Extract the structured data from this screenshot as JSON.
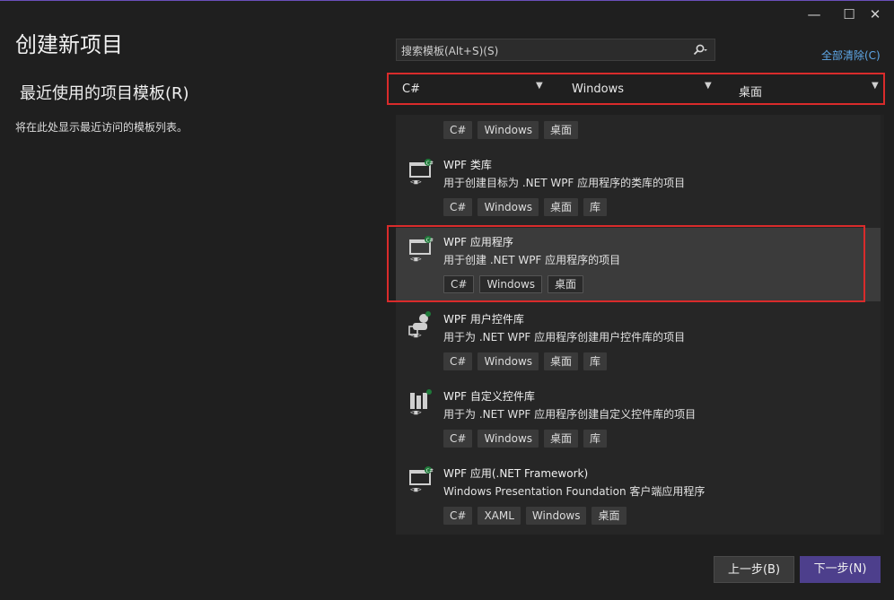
{
  "window": {
    "minimize_glyph": "—",
    "maximize_glyph": "☐",
    "close_glyph": "✕"
  },
  "page": {
    "title": "创建新项目",
    "recent_title": "最近使用的项目模板(R)",
    "recent_desc": "将在此处显示最近访问的模板列表。"
  },
  "search": {
    "placeholder": "搜索模板(Alt+S)(S)",
    "icon": "search-icon"
  },
  "clear_all": "全部清除(C)",
  "filters": {
    "language": "C#",
    "platform": "Windows",
    "project_type": "桌面"
  },
  "templates": [
    {
      "name": "",
      "desc": "",
      "tags": [
        "C#",
        "Windows",
        "桌面"
      ],
      "icon": "partial-item"
    },
    {
      "name": "WPF 类库",
      "desc": "用于创建目标为 .NET WPF 应用程序的类库的项目",
      "tags": [
        "C#",
        "Windows",
        "桌面",
        "库"
      ],
      "icon": "wpf-window-icon"
    },
    {
      "name": "WPF 应用程序",
      "desc": "用于创建 .NET WPF 应用程序的项目",
      "tags": [
        "C#",
        "Windows",
        "桌面"
      ],
      "icon": "wpf-window-icon",
      "selected": true
    },
    {
      "name": "WPF 用户控件库",
      "desc": "用于为 .NET WPF 应用程序创建用户控件库的项目",
      "tags": [
        "C#",
        "Windows",
        "桌面",
        "库"
      ],
      "icon": "wpf-user-control-icon"
    },
    {
      "name": "WPF 自定义控件库",
      "desc": "用于为 .NET WPF 应用程序创建自定义控件库的项目",
      "tags": [
        "C#",
        "Windows",
        "桌面",
        "库"
      ],
      "icon": "wpf-custom-control-icon"
    },
    {
      "name": "WPF 应用(.NET Framework)",
      "desc": "Windows Presentation Foundation 客户端应用程序",
      "tags": [
        "C#",
        "XAML",
        "Windows",
        "桌面"
      ],
      "icon": "wpf-window-icon"
    }
  ],
  "buttons": {
    "back": "上一步(B)",
    "next": "下一步(N)"
  },
  "colors": {
    "accent": "#4d3f8c",
    "highlight_outline": "#d92b2b",
    "link": "#5fa8e8"
  }
}
